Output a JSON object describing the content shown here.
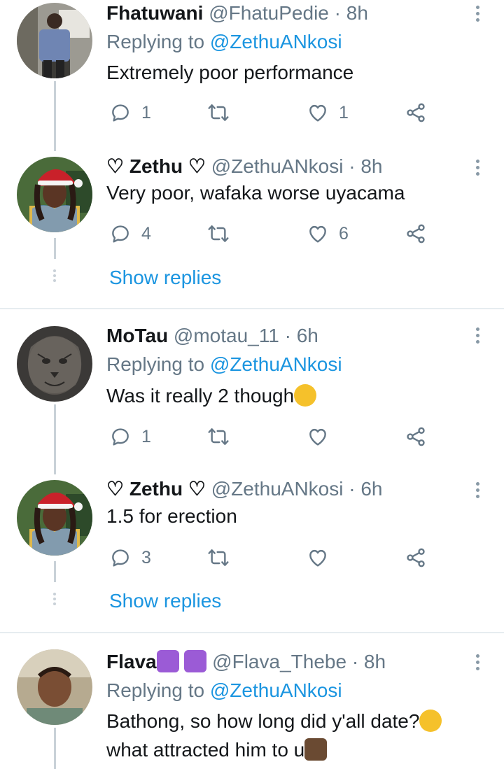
{
  "tweets": [
    {
      "name": "Fhatuwani",
      "handle": "@FhatuPedie",
      "time": "8h",
      "replying_prefix": "Replying to",
      "replying_to": "@ZethuANkosi",
      "text": "Extremely poor performance",
      "replies": "1",
      "retweets": "",
      "likes": "1"
    },
    {
      "name": "♡ Zethu ♡",
      "handle": "@ZethuANkosi",
      "time": "8h",
      "text": "Very poor, wafaka worse uyacama",
      "replies": "4",
      "retweets": "",
      "likes": "6",
      "show_replies": "Show replies"
    },
    {
      "name": "MoTau",
      "handle": "@motau_11",
      "time": "6h",
      "replying_prefix": "Replying to",
      "replying_to": "@ZethuANkosi",
      "text": "Was it really 2 though",
      "replies": "1",
      "retweets": "",
      "likes": ""
    },
    {
      "name": "♡ Zethu ♡",
      "handle": "@ZethuANkosi",
      "time": "6h",
      "text": "1.5 for erection",
      "replies": "3",
      "retweets": "",
      "likes": "",
      "show_replies": "Show replies"
    },
    {
      "name": "Flava",
      "handle": "@Flava_Thebe",
      "time": "8h",
      "replying_prefix": "Replying to",
      "replying_to": "@ZethuANkosi",
      "text_line1": "Bathong, so how long did y'all date?",
      "text_line2": "what attracted him to u"
    }
  ],
  "separator": "·",
  "icons": {
    "reply": "reply-icon",
    "retweet": "retweet-icon",
    "like": "heart-icon",
    "share": "share-icon",
    "more": "more-vertical-icon"
  },
  "colors": {
    "link": "#1b95e0",
    "secondary": "#657786",
    "thread_line": "#c9d1d8",
    "divider": "#e6ecf0"
  }
}
